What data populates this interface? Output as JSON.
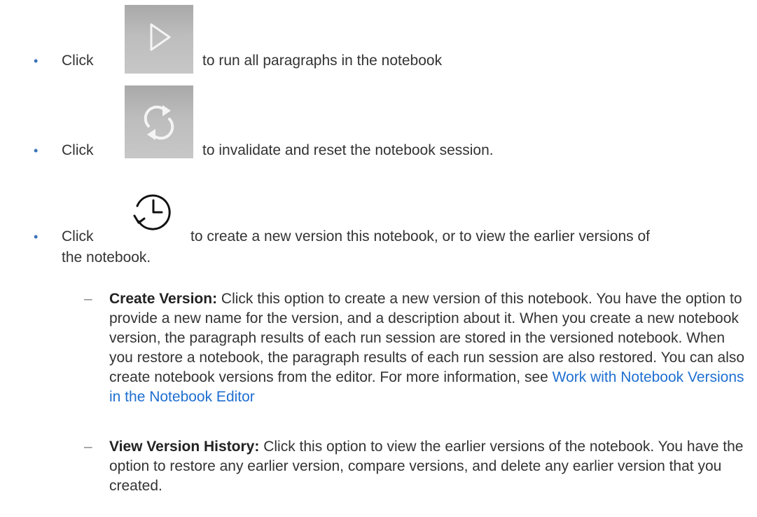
{
  "items": [
    {
      "prefix": "Click",
      "suffix": "to run all paragraphs in the notebook",
      "icon": "play-icon"
    },
    {
      "prefix": "Click",
      "suffix": "to invalidate and reset the notebook session.",
      "icon": "refresh-icon"
    },
    {
      "prefix": "Click",
      "suffix_line1": "to create a new version this notebook, or to view the earlier versions of",
      "suffix_line2": "the notebook.",
      "icon": "history-clock-icon"
    }
  ],
  "subitems": {
    "create": {
      "term": "Create Version:",
      "text": "Click this option to create a new version of this notebook. You have the option to provide a new name for the version, and a description about it. When you create a new notebook version, the paragraph results of each run session are stored in the versioned notebook. When you restore a notebook, the paragraph results of each run session are also restored. You can also create notebook versions from the editor. For more information, see ",
      "link": "Work with Notebook Versions in the Notebook Editor"
    },
    "history": {
      "term": "View Version History:",
      "text": "Click this option to view the earlier versions of the notebook. You have the option to restore any earlier version, compare versions, and delete any earlier version that you created."
    }
  },
  "bullet_char": "•",
  "dash_char": "–",
  "colors": {
    "link": "#1f6fd1",
    "bullet": "#3a73b8",
    "icon_bg": "#bdbdbd",
    "icon_stroke": "#f4f4f4"
  }
}
